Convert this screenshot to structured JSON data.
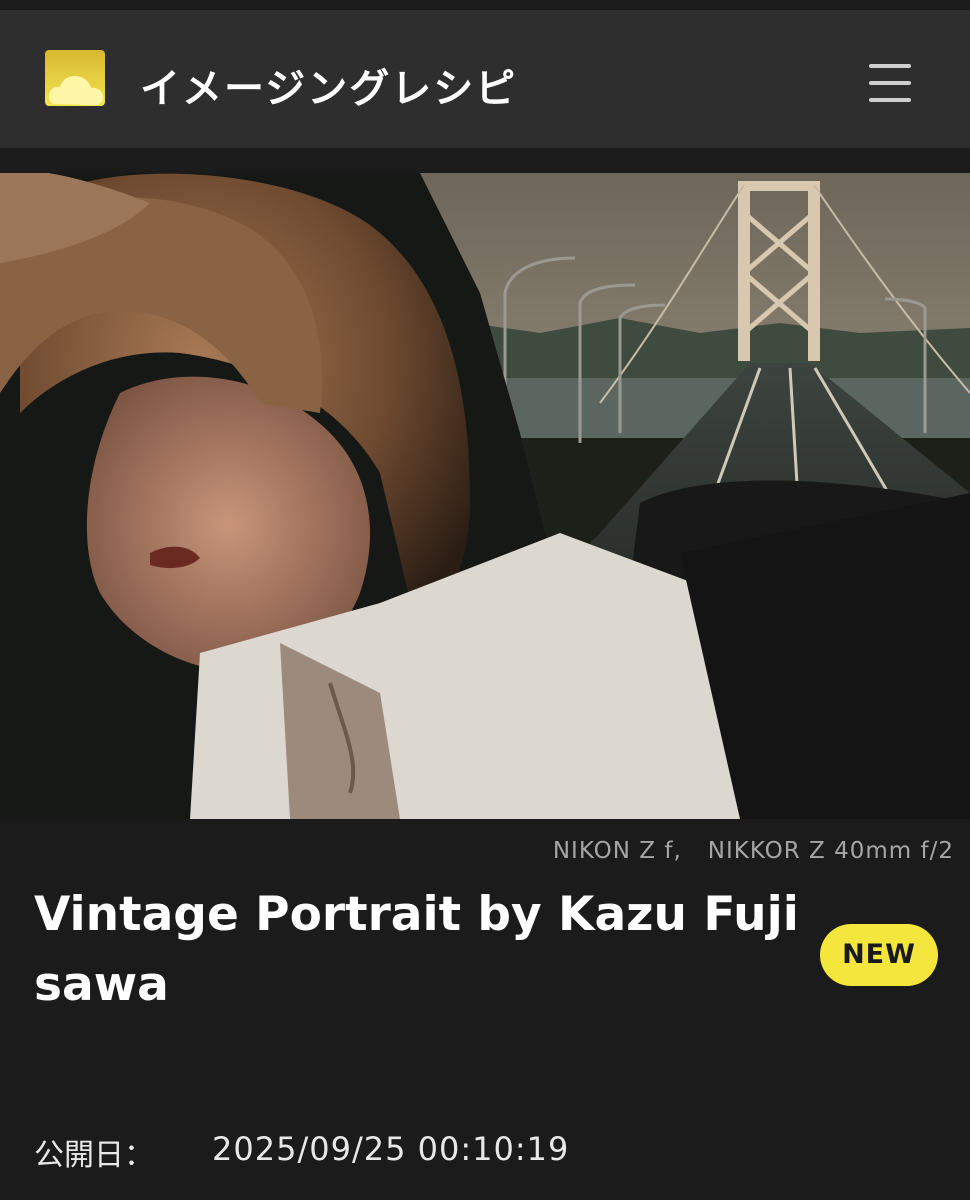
{
  "header": {
    "app_title": "イメージングレシピ",
    "logo_icon": "cloud-sun-icon",
    "menu_icon": "hamburger-menu-icon",
    "accent_color": "#f4e63c"
  },
  "recipe": {
    "image_icon": "portrait-photo",
    "camera": "NIKON Z f,",
    "lens": "NIKKOR Z 40mm f/2",
    "title": "Vintage Portrait by Kazu Fujisawa",
    "badge": "NEW",
    "published_label": "公開日：",
    "published_value": "2025/09/25 00:10:19"
  }
}
